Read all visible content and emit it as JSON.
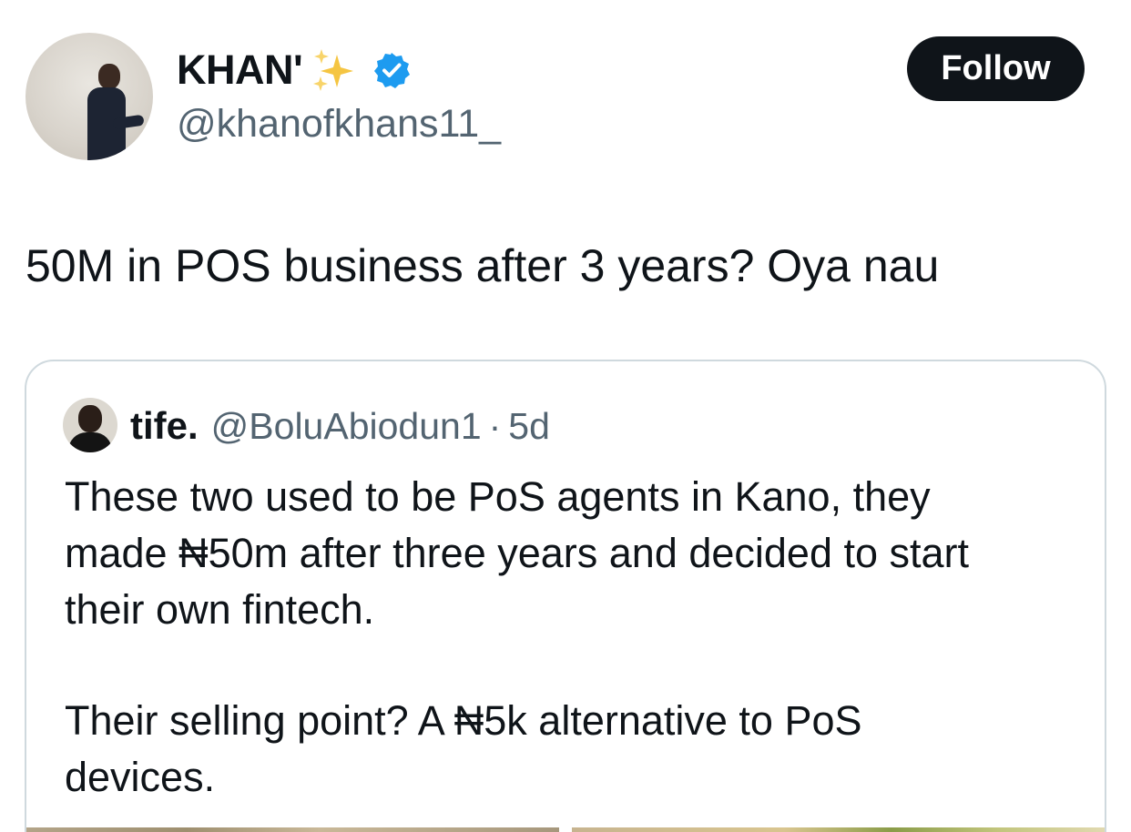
{
  "tweet": {
    "author": {
      "display_name": "KHAN'",
      "name_emoji": "sparkles-icon",
      "verified": true,
      "handle": "@khanofkhans11_"
    },
    "follow_label": "Follow",
    "text": "50M in POS business after 3 years? Oya nau"
  },
  "quoted_tweet": {
    "author": {
      "display_name": "tife.",
      "handle": "@BoluAbiodun1",
      "separator": "·",
      "time": "5d"
    },
    "paragraph_1": "These two used to be PoS agents in Kano, they\nmade ₦50m after three years and decided to start\ntheir own fintech.",
    "paragraph_2": "Their selling point? A ₦5k alternative to PoS\ndevices."
  },
  "colors": {
    "text_primary": "#0f1419",
    "text_secondary": "#536471",
    "verified_blue": "#1d9bf0",
    "sparkle_gold": "#f5c542",
    "card_border": "#cfd9de"
  }
}
